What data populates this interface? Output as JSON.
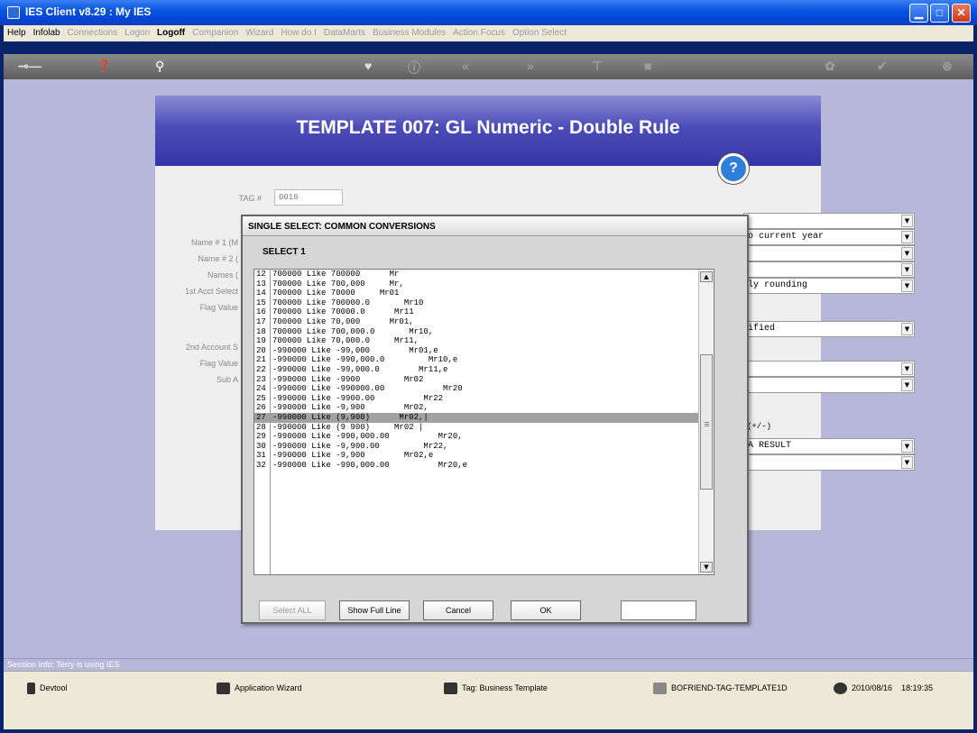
{
  "window": {
    "title": "IES Client v8.29 : My IES",
    "min_label": "▁",
    "max_label": "□",
    "close_label": "✕"
  },
  "menu": {
    "items": [
      {
        "label": "Help",
        "state": "on"
      },
      {
        "label": "Infolab",
        "state": "on"
      },
      {
        "label": "Connections",
        "state": "off"
      },
      {
        "label": "Logon",
        "state": "off"
      },
      {
        "label": "Logoff",
        "state": "strong"
      },
      {
        "label": "Companion",
        "state": "off"
      },
      {
        "label": "Wizard",
        "state": "off"
      },
      {
        "label": "How do I",
        "state": "off"
      },
      {
        "label": "DataMarts",
        "state": "off"
      },
      {
        "label": "Business Modules",
        "state": "off"
      },
      {
        "label": "Action Focus",
        "state": "off"
      },
      {
        "label": "Option Select",
        "state": "off"
      }
    ]
  },
  "toolbar": {
    "icons": [
      "key-icon",
      "help-icon",
      "search-icon",
      "heart-icon",
      "info-icon",
      "back-icon",
      "forward-icon",
      "tree-icon",
      "stop-icon",
      "palette-icon",
      "check-icon",
      "close-icon"
    ]
  },
  "template": {
    "title": "TEMPLATE 007: GL Numeric   - Double Rule",
    "help_label": "?",
    "tag_label": "TAG #",
    "tag_value": "0016",
    "left_labels": [
      "Name # 1 (M",
      "Name # 2 (",
      "Names (",
      "1st Acct Select",
      "Flag Value",
      "2nd Account S",
      "Flag Value",
      "Sub A"
    ],
    "right_fields": [
      {
        "value": ""
      },
      {
        "value": "o current year"
      },
      {
        "value": ""
      },
      {
        "value": ""
      },
      {
        "value": "ly rounding"
      },
      {
        "value": "ified"
      },
      {
        "value": ""
      },
      {
        "value": ""
      },
      {
        "value": "A RESULT"
      },
      {
        "value": ""
      }
    ],
    "right_note": "(+/-)"
  },
  "dialog": {
    "title": "SINGLE SELECT: COMMON CONVERSIONS",
    "subtitle": "SELECT 1",
    "rows": [
      {
        "num": "12",
        "text": "700000 Like 700000      Mr"
      },
      {
        "num": "13",
        "text": "700000 Like 700,000     Mr,"
      },
      {
        "num": "14",
        "text": "700000 Like 70000     Mr01"
      },
      {
        "num": "15",
        "text": "700000 Like 700000.0       Mr10"
      },
      {
        "num": "16",
        "text": "700000 Like 70000.0      Mr11"
      },
      {
        "num": "17",
        "text": "700000 Like 70,000      Mr01,"
      },
      {
        "num": "18",
        "text": "700000 Like 700,000.0       Mr10,"
      },
      {
        "num": "19",
        "text": "700000 Like 70,000.0     Mr11,"
      },
      {
        "num": "20",
        "text": "-990000 Like -99,000        Mr01,e"
      },
      {
        "num": "21",
        "text": "-990000 Like -990,000.0         Mr10,e"
      },
      {
        "num": "22",
        "text": "-990000 Like -99,000.0        Mr11,e"
      },
      {
        "num": "23",
        "text": "-990000 Like -9900         Mr02"
      },
      {
        "num": "24",
        "text": "-990000 Like -990000.00            Mr20"
      },
      {
        "num": "25",
        "text": "-990000 Like -9900.00          Mr22"
      },
      {
        "num": "26",
        "text": "-990000 Like -9,900        Mr02,"
      },
      {
        "num": "27",
        "text": "-990000 Like (9,900)      Mr02,|"
      },
      {
        "num": "28",
        "text": "-990000 Like (9 900)     Mr02 |"
      },
      {
        "num": "29",
        "text": "-990000 Like -990,000.00          Mr20,"
      },
      {
        "num": "30",
        "text": "-990000 Like -9,900.00         Mr22,"
      },
      {
        "num": "31",
        "text": "-990000 Like -9,900        Mr02,e"
      },
      {
        "num": "32",
        "text": "-990000 Like -990,000.00          Mr20,e"
      }
    ],
    "selected_row": "27",
    "scroll_up": "▲",
    "scroll_down": "▼",
    "buttons": {
      "select_all": "Select ALL",
      "show_full_line": "Show Full Line",
      "cancel": "Cancel",
      "ok": "OK"
    }
  },
  "session": "Session Info: Terry is using IES",
  "taskbar": {
    "devtool": "Devtool",
    "wizard": "Application Wizard",
    "tag": "Tag: Business Template",
    "module": "BOFRIEND-TAG-TEMPLATE1D",
    "date": "2010/08/16",
    "time": "18:19:35"
  }
}
